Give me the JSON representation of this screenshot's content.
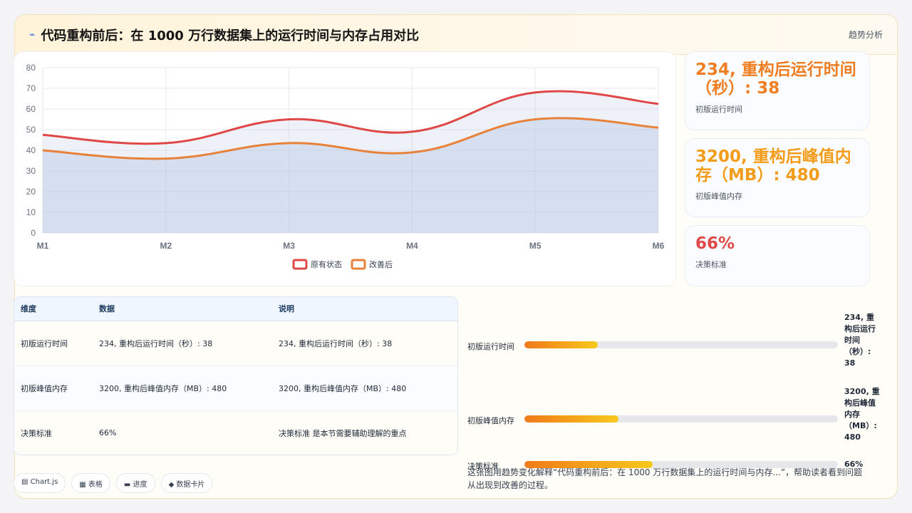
{
  "header": {
    "icon": "bolt-icon",
    "title": "代码重构前后：在 1000 万行数据集上的运行时间与内存占用对比",
    "trend_label": "趋势分析"
  },
  "chart_data": {
    "type": "area",
    "categories": [
      "M1",
      "M2",
      "M3",
      "M4",
      "M5",
      "M6"
    ],
    "ylim": [
      0,
      80
    ],
    "yticks": [
      0,
      10,
      20,
      30,
      40,
      50,
      60,
      70,
      80
    ],
    "grid": true,
    "legend_position": "bottom",
    "series": [
      {
        "name": "原有状态",
        "values": [
          47.5,
          43.5,
          55,
          49,
          68,
          62.5
        ],
        "color": "#e04848"
      },
      {
        "name": "改善后",
        "values": [
          40,
          36,
          43.5,
          39,
          55,
          51
        ],
        "color": "#e8823a"
      }
    ]
  },
  "stats": [
    {
      "value": "234, 重构后运行时间（秒）: 38",
      "label": "初版运行时间",
      "color": "#ef7d22"
    },
    {
      "value": "3200, 重构后峰值内存（MB）: 480",
      "label": "初版峰值内存",
      "color": "#f39c1a"
    },
    {
      "value": "66%",
      "label": "决策标准",
      "color": "#e04848"
    }
  ],
  "table": {
    "headers": [
      "维度",
      "数据",
      "说明"
    ],
    "rows": [
      [
        "初版运行时间",
        "234, 重构后运行时间（秒）: 38",
        "234, 重构后运行时间（秒）: 38"
      ],
      [
        "初版峰值内存",
        "3200, 重构后峰值内存（MB）: 480",
        "3200, 重构后峰值内存（MB）: 480"
      ],
      [
        "决策标准",
        "66%",
        "决策标准 是本节需要辅助理解的重点"
      ]
    ]
  },
  "bars": [
    {
      "label": "初版运行时间",
      "value": "234, 重构后运行时间（秒）: 38",
      "fraction": 0.234
    },
    {
      "label": "初版峰值内存",
      "value": "3200, 重构后峰值内存（MB）: 480",
      "fraction": 0.3
    },
    {
      "label": "决策标准",
      "value": "66%",
      "fraction": 0.41
    }
  ],
  "chips": [
    "▤ Chart.js",
    "▦ 表格",
    "▬ 进度",
    "◆ 数据卡片"
  ],
  "description": "这张图用趋势变化解释“代码重构前后：在 1000 万行数据集上的运行时间与内存...”，帮助读者看到问题从出现到改善的过程。"
}
